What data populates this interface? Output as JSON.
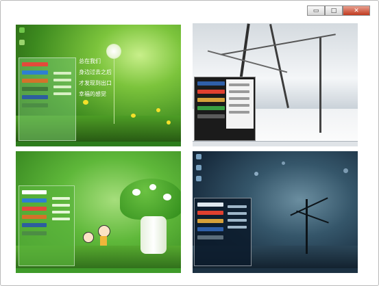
{
  "window": {
    "minimize_icon": "minimize-icon",
    "maximize_icon": "maximize-icon",
    "close_icon": "close-icon",
    "minimize_glyph": "▭",
    "maximize_glyph": "□",
    "close_glyph": "✕"
  },
  "panels": {
    "green_dandelion": {
      "poem": [
        "总在我们",
        "身边过去之后",
        "才发现到出口",
        "幸福的感觉"
      ]
    },
    "winter_snow": {},
    "green_mushroom": {},
    "night_tree": {}
  },
  "colors": {
    "green_theme": "#3f9b2a",
    "snow_theme": "#e8ecef",
    "mushroom_theme": "#52b23c",
    "night_theme": "#1c3142"
  }
}
